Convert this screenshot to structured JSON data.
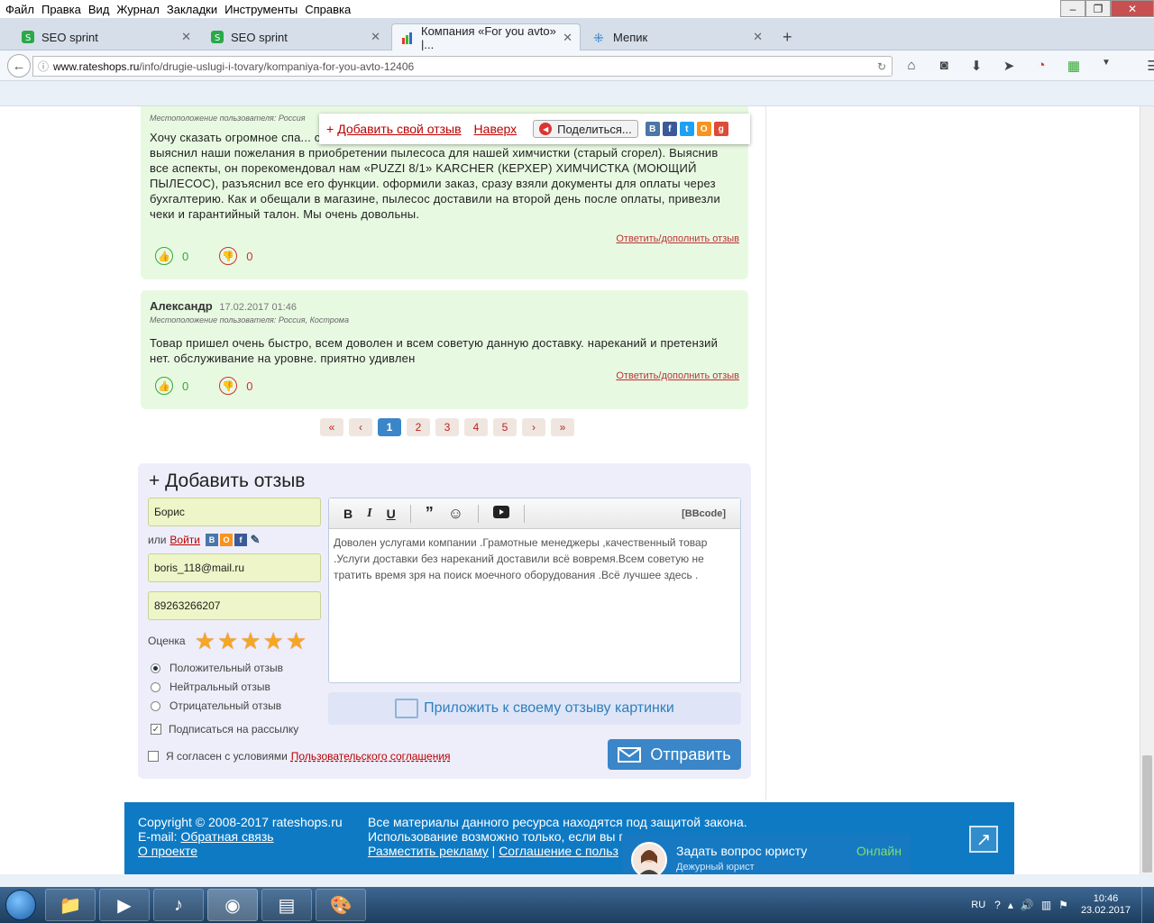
{
  "menu": [
    "Файл",
    "Правка",
    "Вид",
    "Журнал",
    "Закладки",
    "Инструменты",
    "Справка"
  ],
  "tabs": [
    {
      "label": "SEO sprint"
    },
    {
      "label": "SEO sprint"
    },
    {
      "label": "Компания «For you avto» |..."
    },
    {
      "label": "Мепик"
    }
  ],
  "new_tab": "+",
  "url": {
    "domain": "www.rateshops.ru",
    "path": "/info/drugie-uslugi-i-tovary/kompaniya-for-you-avto-12406"
  },
  "floatbar": {
    "add_review": "Добавить свой отзыв",
    "to_top": "Наверх",
    "share": "Поделиться..."
  },
  "reviews": [
    {
      "location": "Местоположение пользователя: Россия",
      "text": "Хочу сказать огромное спа... с клиентами. При обращении в магазин менеджер спокойно и грамотно выяснил наши пожелания в приобретении  пылесоса для нашей химчистки (старый сгорел). Выяснив все аспекты, он порекомендовал нам «PUZZI 8/1» KARCHER (КЕРХЕР) ХИМЧИСТКА (МОЮЩИЙ ПЫЛЕСОС),  разъяснил все его функции. оформили заказ, сразу взяли документы для оплаты через бухгалтерию. Как и обещали в магазине, пылесос доставили на второй день после оплаты, привезли чеки и гарантийный талон. Мы очень довольны.",
      "reply": "Ответить/дополнить отзыв",
      "likes": "0",
      "dislikes": "0"
    },
    {
      "author": "Александр",
      "date": "17.02.2017 01:46",
      "location": "Местоположение пользователя: Россия, Кострома",
      "text": "Товар пришел очень быстро, всем доволен и всем советую данную доставку. нареканий и претензий нет. обслуживание на уровне. приятно удивлен",
      "reply": "Ответить/дополнить отзыв",
      "likes": "0",
      "dislikes": "0"
    }
  ],
  "pagination": [
    "«",
    "‹",
    "1",
    "2",
    "3",
    "4",
    "5",
    "›",
    "»"
  ],
  "form": {
    "title": "+ Добавить отзыв",
    "name": "Борис",
    "or": "или",
    "login": "Войти",
    "email": "boris_118@mail.ru",
    "phone": "89263266207",
    "rating_label": "Оценка",
    "stars": 5,
    "bbcode": "[BBcode]",
    "text": "Доволен услугами компании .Грамотные менеджеры ,качественный товар .Услуги доставки без нареканий доставили всё вовремя.Всем советую не тратить время зря на поиск моечного оборудования .Всё лучшее здесь .",
    "type_positive": "Положительный отзыв",
    "type_neutral": "Нейтральный отзыв",
    "type_negative": "Отрицательный отзыв",
    "subscribe": "Подписаться на рассылку",
    "agree": "Я согласен с условиями",
    "agreement_link": "Пользовательского соглашения",
    "attach": "Приложить к своему отзыву картинки",
    "send": "Отправить"
  },
  "footer": {
    "copyright": "Copyright © 2008-2017 rateshops.ru",
    "email_label": "E-mail:",
    "feedback": "Обратная связь",
    "about": "О проекте",
    "law": "Все материалы данного ресурса находятся под защитой закона.",
    "usage": "Использование возможно только, если вы п",
    "ads": "Разместить рекламу",
    "sep": "|",
    "agreement": "Соглашение с польз"
  },
  "chat": {
    "title": "Задать вопрос юристу",
    "subtitle": "Дежурный юрист",
    "status": "Онлайн"
  },
  "tray": {
    "lang": "RU",
    "time": "10:46",
    "date": "23.02.2017"
  }
}
